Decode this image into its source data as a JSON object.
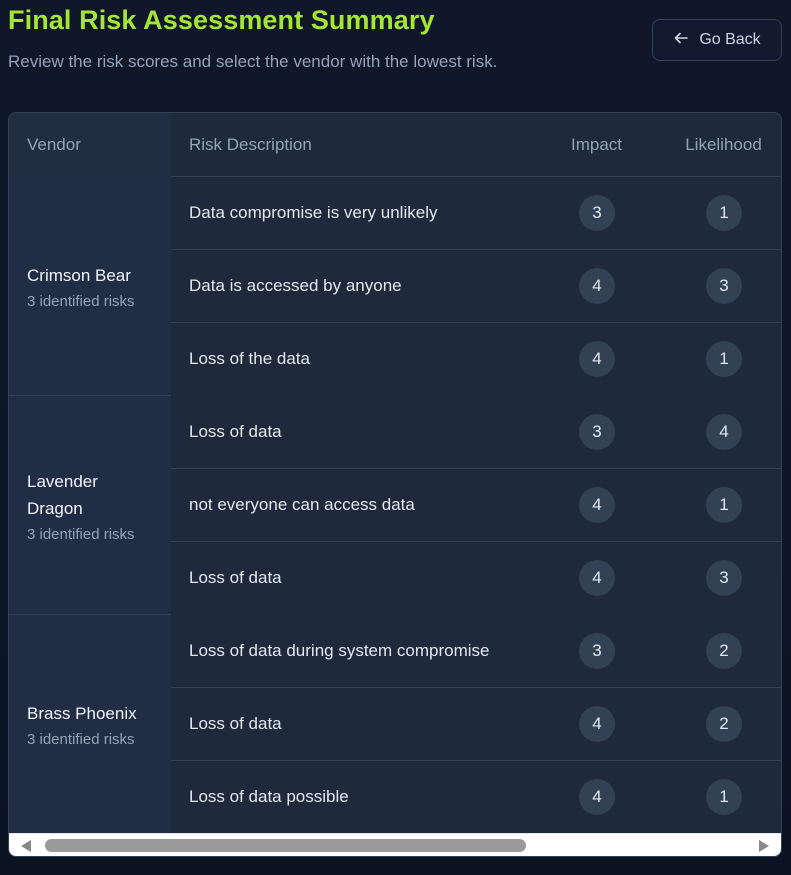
{
  "header": {
    "title": "Final Risk Assessment Summary",
    "subtitle": "Review the risk scores and select the vendor with the lowest risk.",
    "back_label": "Go Back"
  },
  "table": {
    "columns": [
      "Vendor",
      "Risk Description",
      "Impact",
      "Likelihood"
    ],
    "vendors": [
      {
        "name": "Crimson Bear",
        "count": "3 identified risks",
        "risks": [
          {
            "desc": "Data compromise is very unlikely",
            "impact": "3",
            "likelihood": "1"
          },
          {
            "desc": "Data is accessed by anyone",
            "impact": "4",
            "likelihood": "3"
          },
          {
            "desc": "Loss of the data",
            "impact": "4",
            "likelihood": "1"
          }
        ]
      },
      {
        "name": "Lavender Dragon",
        "count": "3 identified risks",
        "risks": [
          {
            "desc": "Loss of data",
            "impact": "3",
            "likelihood": "4"
          },
          {
            "desc": "not everyone can access data",
            "impact": "4",
            "likelihood": "1"
          },
          {
            "desc": "Loss of data",
            "impact": "4",
            "likelihood": "3"
          }
        ]
      },
      {
        "name": "Brass Phoenix",
        "count": "3 identified risks",
        "risks": [
          {
            "desc": "Loss of data during system compromise",
            "impact": "3",
            "likelihood": "2"
          },
          {
            "desc": "Loss of data",
            "impact": "4",
            "likelihood": "2"
          },
          {
            "desc": "Loss of data possible",
            "impact": "4",
            "likelihood": "1"
          }
        ]
      }
    ]
  },
  "icons": {
    "back": "arrow-left-icon",
    "scroll_left": "scroll-left-arrow-icon",
    "scroll_right": "scroll-right-arrow-icon"
  },
  "colors": {
    "accent": "#a3e635",
    "background": "#0f1729",
    "badge": "#334155"
  }
}
